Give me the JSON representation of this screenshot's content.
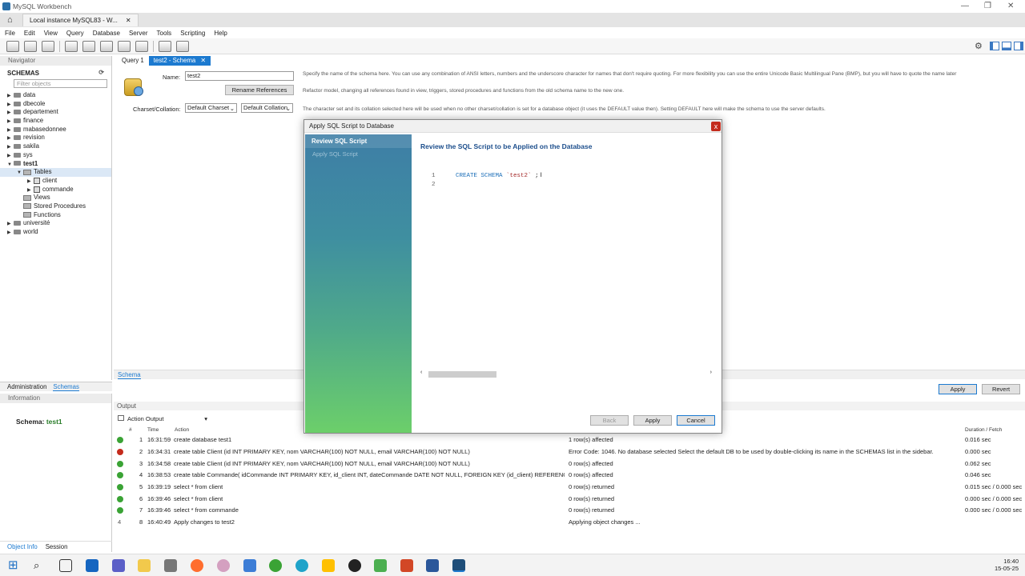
{
  "app_title": "MySQL Workbench",
  "connection_tab": "Local instance MySQL83 - W...",
  "menu": [
    "File",
    "Edit",
    "View",
    "Query",
    "Database",
    "Server",
    "Tools",
    "Scripting",
    "Help"
  ],
  "navigator": {
    "header": "Navigator",
    "schemas_label": "SCHEMAS",
    "filter_placeholder": "Filter objects",
    "items": [
      "data",
      "dbecole",
      "departement",
      "finance",
      "mabasedonnee",
      "revision",
      "sakila",
      "sys",
      "test1",
      "Tables",
      "client",
      "commande",
      "Views",
      "Stored Procedures",
      "Functions",
      "université",
      "world"
    ],
    "bottom_tabs": [
      "Administration",
      "Schemas"
    ]
  },
  "info_panel": {
    "header": "Information",
    "schema_label": "Schema:",
    "schema_value": "test1",
    "bottom_tabs": [
      "Object Info",
      "Session"
    ]
  },
  "editor": {
    "tabs": [
      "Query 1",
      "test2 - Schema"
    ],
    "name_label": "Name:",
    "name_value": "test2",
    "rename_button": "Rename References",
    "charset_label": "Charset/Collation:",
    "charset_value": "Default Charset",
    "collation_value": "Default Collation",
    "desc1": "Specify the name of the schema here. You can use any combination of ANSI letters, numbers and the underscore character for names that don't require quoting. For more flexibility you can use the entire Unicode Basic Multilingual Pane (BMP), but you will have to quote the name later",
    "desc2": "Refactor model, changing all references found in view, triggers, stored procedures and functions from the old schema name to the new one.",
    "desc3": "The character set and its collation selected here will be used when no other charset/collation is set for a database object (it uses the DEFAULT value then). Setting DEFAULT here will make the schema to use the server defaults.",
    "bottom_tab": "Schema",
    "apply_button": "Apply",
    "revert_button": "Revert"
  },
  "dialog": {
    "title": "Apply SQL Script to Database",
    "close": "x",
    "steps": [
      "Review SQL Script",
      "Apply SQL Script"
    ],
    "heading": "Review the SQL Script to be Applied on the Database",
    "code": {
      "ln1": "1",
      "ln2": "2",
      "kw": "CREATE SCHEMA",
      "str": "`test2`",
      "end": ";"
    },
    "buttons": {
      "back": "Back",
      "apply": "Apply",
      "cancel": "Cancel"
    }
  },
  "output": {
    "header": "Output",
    "dropdown": "Action Output",
    "columns": {
      "num": "#",
      "time": "Time",
      "action": "Action",
      "message": "Message",
      "duration": "Duration / Fetch"
    },
    "rows": [
      {
        "status": "ok",
        "n": "1",
        "time": "16:31:59",
        "action": "create database test1",
        "message": "1 row(s) affected",
        "duration": "0.016 sec"
      },
      {
        "status": "error",
        "n": "2",
        "time": "16:34:31",
        "action": "create table Client (id INT PRIMARY KEY, nom VARCHAR(100) NOT NULL, email VARCHAR(100) NOT NULL)",
        "message": "Error Code: 1046. No database selected Select the default DB to be used by double-clicking its name in the SCHEMAS list in the sidebar.",
        "duration": "0.000 sec"
      },
      {
        "status": "ok",
        "n": "3",
        "time": "16:34:58",
        "action": "create table Client (id INT PRIMARY KEY, nom VARCHAR(100) NOT NULL, email VARCHAR(100) NOT NULL)",
        "message": "0 row(s) affected",
        "duration": "0.062 sec"
      },
      {
        "status": "ok",
        "n": "4",
        "time": "16:38:53",
        "action": "create table Commande( idCommande INT PRIMARY KEY,  id_client INT,  dateCommande DATE NOT NULL, FOREIGN KEY (id_client) REFERENCES ...",
        "message": "0 row(s) affected",
        "duration": "0.046 sec"
      },
      {
        "status": "ok",
        "n": "5",
        "time": "16:39:19",
        "action": "select * from client",
        "message": "0 row(s) returned",
        "duration": "0.015 sec / 0.000 sec"
      },
      {
        "status": "ok",
        "n": "6",
        "time": "16:39:46",
        "action": "select * from client",
        "message": "0 row(s) returned",
        "duration": "0.000 sec / 0.000 sec"
      },
      {
        "status": "ok",
        "n": "7",
        "time": "16:39:46",
        "action": "select * from commande",
        "message": "0 row(s) returned",
        "duration": "0.000 sec / 0.000 sec"
      },
      {
        "status": "pending",
        "n": "8",
        "time": "16:40:49",
        "action": "Apply changes to test2",
        "message": "Applying object changes ...",
        "duration": ""
      }
    ]
  },
  "taskbar": {
    "time": "16:40",
    "date": "15-05-25"
  }
}
